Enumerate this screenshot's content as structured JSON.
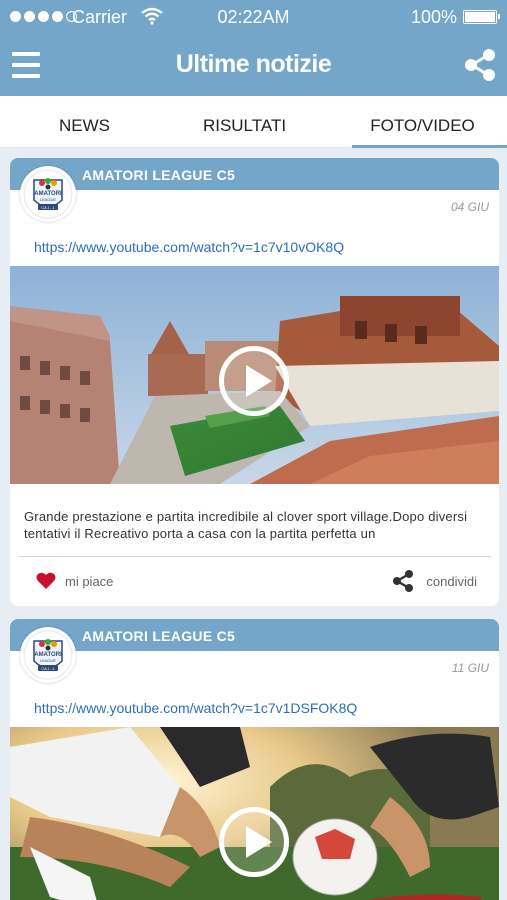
{
  "status": {
    "carrier": "Carrier",
    "time": "02:22AM",
    "battery": "100%"
  },
  "header": {
    "title": "Ultime notizie"
  },
  "tabs": [
    {
      "label": "NEWS"
    },
    {
      "label": "RISULTATI"
    },
    {
      "label": "FOTO/VIDEO",
      "active": true
    }
  ],
  "posts": [
    {
      "league": "AMATORI LEAGUE C5",
      "date": "04 GIU",
      "url": "https://www.youtube.com/watch?v=1c7v10vOK8Q",
      "text": "Grande prestazione e partita incredibile al clover sport village.Dopo diversi tentativi il Recreativo porta a casa con la partita perfetta un",
      "like_label": "mi piace",
      "share_label": "condividi"
    },
    {
      "league": "AMATORI LEAGUE C5",
      "date": "11 GIU",
      "url": "https://www.youtube.com/watch?v=1c7v1DSFOK8Q"
    }
  ],
  "logo": {
    "text_top": "AMATORI",
    "text_mid": "LEAGUE",
    "text_bottom": "CA.I - 1"
  },
  "colors": {
    "accent": "#73a6c9",
    "link": "#2a6fc0",
    "heart": "#c8102e"
  }
}
